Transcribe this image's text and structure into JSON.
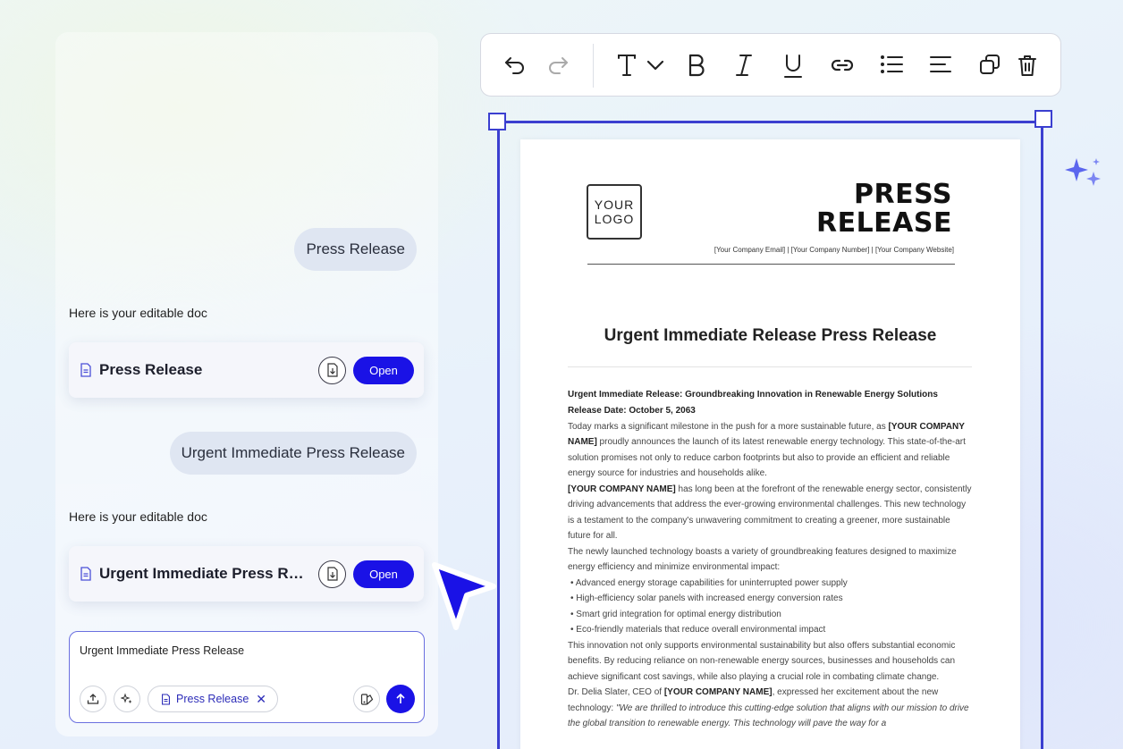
{
  "chat": {
    "user_message_1": "Press Release",
    "assistant_text_1": "Here is your editable doc",
    "card_1": {
      "title": "Press Release",
      "open_label": "Open"
    },
    "user_message_2": "Urgent Immediate Press Release",
    "assistant_text_2": "Here is your editable doc",
    "card_2": {
      "title": "Urgent Immediate Press Release",
      "open_label": "Open"
    },
    "composer": {
      "text": "Urgent Immediate Press Release",
      "chip_label": "Press Release"
    }
  },
  "toolbar": {
    "icons": [
      "undo-icon",
      "redo-icon",
      "text-style-icon",
      "bold-icon",
      "italic-icon",
      "underline-icon",
      "link-icon",
      "list-icon",
      "align-icon",
      "duplicate-icon",
      "delete-icon"
    ]
  },
  "document": {
    "logo_line1": "YOUR",
    "logo_line2": "LOGO",
    "title_line1": "PRESS",
    "title_line2": "RELEASE",
    "contact": "[Your Company Email] | [Your Company Number] | [Your Company Website]",
    "heading": "Urgent Immediate Release Press Release",
    "subheading": "Urgent Immediate Release: Groundbreaking Innovation in Renewable Energy Solutions",
    "release_date": "Release Date: October 5, 2063",
    "p1_a": "Today marks a significant milestone in the push for a more sustainable future, as ",
    "company_placeholder": "[YOUR COMPANY NAME]",
    "p1_b": " proudly announces the launch of its latest renewable energy technology. This state-of-the-art solution promises not only to reduce carbon footprints but also to provide an efficient and reliable energy source for industries and households alike.",
    "p2_b": " has long been at the forefront of the renewable energy sector, consistently driving advancements that address the ever-growing environmental challenges. This new technology is a testament to the company's unwavering commitment to creating a greener, more sustainable future for all.",
    "p3": "The newly launched technology boasts a variety of groundbreaking features designed to maximize energy efficiency and minimize environmental impact:",
    "bullets": [
      "Advanced energy storage capabilities for uninterrupted power supply",
      "High-efficiency solar panels with increased energy conversion rates",
      "Smart grid integration for optimal energy distribution",
      "Eco-friendly materials that reduce overall environmental impact"
    ],
    "p4": "This innovation not only supports environmental sustainability but also offers substantial economic benefits. By reducing reliance on non-renewable energy sources, businesses and households can achieve significant cost savings, while also playing a crucial role in combating climate change.",
    "p5_a": "Dr. Delia Slater, CEO of ",
    "p5_b": ", expressed her excitement about the new technology: ",
    "quote": "\"We are thrilled to introduce this cutting-edge solution that aligns with our mission to drive the global transition to renewable energy. This technology will pave the way for a"
  }
}
